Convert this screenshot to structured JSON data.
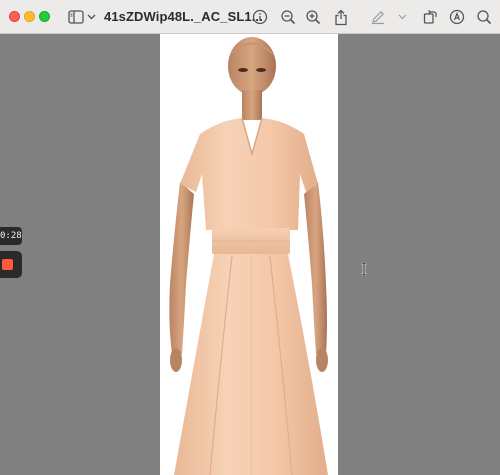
{
  "window": {
    "title": "41sZDWip48L._AC_SL1...",
    "controls": [
      "close",
      "minimize",
      "zoom"
    ]
  },
  "toolbar": {
    "icons": [
      "sidebar-toggle-icon",
      "chevron-down-icon",
      "info-icon",
      "zoom-out-icon",
      "zoom-in-icon",
      "share-icon",
      "markup-pen-icon",
      "chevron-down-icon",
      "rotate-icon",
      "markup-circle-icon",
      "search-icon"
    ]
  },
  "recording": {
    "timer": "0:28"
  },
  "colors": {
    "toolbar_bg": "#ecebea",
    "viewer_bg": "#808080",
    "dress": "#f4c7a8",
    "record_dot": "#ff5a3c"
  }
}
